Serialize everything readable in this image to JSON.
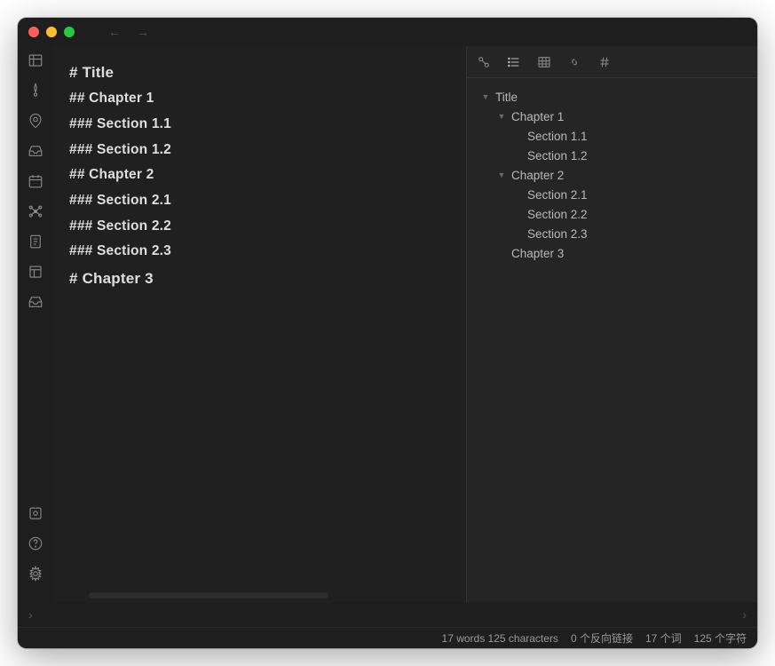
{
  "titlebar": {
    "back_icon": "←",
    "forward_icon": "→"
  },
  "left_rail": {
    "icons": [
      {
        "name": "files-icon"
      },
      {
        "name": "tag-icon"
      },
      {
        "name": "location-icon"
      },
      {
        "name": "inbox-icon"
      },
      {
        "name": "calendar-icon"
      },
      {
        "name": "graph-icon"
      },
      {
        "name": "notes-icon"
      },
      {
        "name": "template-icon"
      },
      {
        "name": "archive-icon"
      }
    ],
    "bottom_icons": [
      {
        "name": "vault-icon"
      },
      {
        "name": "help-icon"
      },
      {
        "name": "settings-icon"
      }
    ]
  },
  "editor": {
    "lines": [
      {
        "level": 1,
        "text": "# Title"
      },
      {
        "level": 2,
        "text": "## Chapter 1"
      },
      {
        "level": 3,
        "text": "### Section 1.1"
      },
      {
        "level": 3,
        "text": "### Section 1.2"
      },
      {
        "level": 2,
        "text": "## Chapter 2"
      },
      {
        "level": 3,
        "text": "### Section 2.1"
      },
      {
        "level": 3,
        "text": "### Section 2.2"
      },
      {
        "level": 3,
        "text": "### Section 2.3"
      },
      {
        "level": 1,
        "text": "# Chapter 3"
      }
    ]
  },
  "sidebar": {
    "tabs": [
      {
        "name": "backlinks-icon",
        "active": false
      },
      {
        "name": "outline-icon",
        "active": true
      },
      {
        "name": "table-icon",
        "active": false
      },
      {
        "name": "link-icon",
        "active": false
      },
      {
        "name": "hash-icon",
        "active": false
      }
    ],
    "outline": [
      {
        "text": "Title",
        "indent": 0,
        "open": true
      },
      {
        "text": "Chapter 1",
        "indent": 1,
        "open": true
      },
      {
        "text": "Section 1.1",
        "indent": 2,
        "leaf": true
      },
      {
        "text": "Section 1.2",
        "indent": 2,
        "leaf": true
      },
      {
        "text": "Chapter 2",
        "indent": 1,
        "open": true
      },
      {
        "text": "Section 2.1",
        "indent": 2,
        "leaf": true
      },
      {
        "text": "Section 2.2",
        "indent": 2,
        "leaf": true
      },
      {
        "text": "Section 2.3",
        "indent": 2,
        "leaf": true
      },
      {
        "text": "Chapter 3",
        "indent": 1,
        "leaf": true
      }
    ]
  },
  "statusbar": {
    "words": "17 words 125 characters",
    "backlinks": "0 个反向链接",
    "word_count_cn": "17 个词",
    "char_count_cn": "125 个字符"
  }
}
